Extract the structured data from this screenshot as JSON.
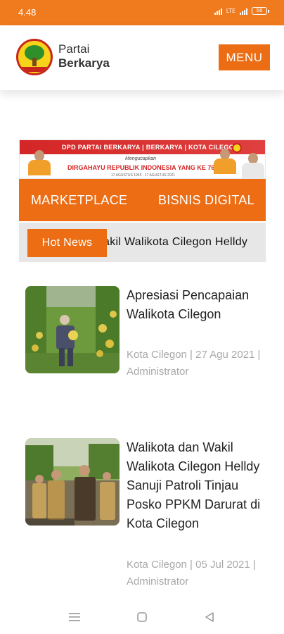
{
  "status_bar": {
    "time": "4.48",
    "network": "LTE",
    "battery": "56"
  },
  "header": {
    "brand_line1": "Partai",
    "brand_line2": "Berkarya",
    "menu_label": "MENU",
    "logo_icon": "partai-berkarya-logo"
  },
  "banner": {
    "title": "DPD PARTAI BERKARYA | BERKARYA | KOTA CILEGON",
    "subtitle": "Mengucapkan",
    "greeting": "DIRGAHAYU REPUBLIK INDONESIA YANG KE 76",
    "dates": "17 AGUSTUS 1945 - 17 AGUSTUS 2021"
  },
  "nav": {
    "items": [
      {
        "label": "MARKETPLACE"
      },
      {
        "label": "BISNIS DIGITAL"
      }
    ]
  },
  "hot_news": {
    "label": "Hot News",
    "ticker": "akil Walikota Cilegon Helldy"
  },
  "articles": [
    {
      "title": "Apresiasi Pencapaian Walikota Cilegon",
      "meta": "Kota Cilegon | 27 Agu 2021 | Administrator",
      "image": "melon-farm-photo"
    },
    {
      "title": "Walikota dan Wakil Walikota Cilegon Helldy Sanuji Patroli Tinjau Posko PPKM Darurat di Kota Cilegon",
      "meta": "Kota Cilegon | 05 Jul 2021 | Administrator",
      "image": "officials-patrol-photo"
    }
  ],
  "system_nav": {
    "recents_icon": "menu-lines-icon",
    "home_icon": "home-square-icon",
    "back_icon": "back-triangle-icon"
  },
  "colors": {
    "accent": "#ec6d14",
    "status_bar": "#f07a1e",
    "hot_bar_bg": "#e7e7e7",
    "meta_text": "#a8a8a8"
  }
}
